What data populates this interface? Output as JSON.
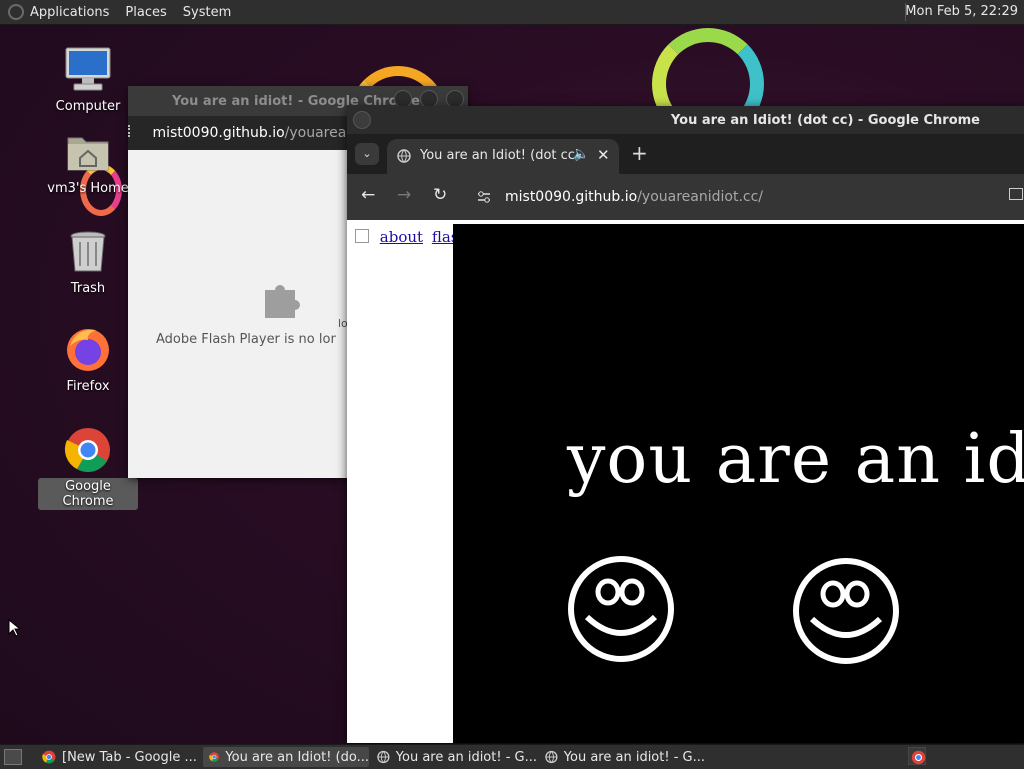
{
  "top_panel": {
    "applications": "Applications",
    "places": "Places",
    "system": "System",
    "clock": "Mon Feb  5, 22:29"
  },
  "desktop_icons": [
    {
      "label": "Computer",
      "icon": "computer-icon"
    },
    {
      "label": "vm3's Home",
      "icon": "home-folder-icon"
    },
    {
      "label": "Trash",
      "icon": "trash-icon"
    },
    {
      "label": "Firefox",
      "icon": "firefox-icon"
    },
    {
      "label": "Google Chrome",
      "icon": "chrome-icon"
    }
  ],
  "back_window": {
    "title": "You are an idiot! - Google Chrome",
    "address_host": "mist0090.github.io",
    "address_path": "/youareanic",
    "plugin_message": "Adobe Flash Player is no longe",
    "partial_text": "lo"
  },
  "front_window": {
    "title": "You are an Idiot! (dot cc) - Google Chrome",
    "tab_title": "You are an Idiot! (dot cc)",
    "address_host": "mist0090.github.io",
    "address_path": "/youareanidiot.cc/",
    "link_about": "about",
    "link_flash": "flash",
    "flash_text": "you are an idi"
  },
  "taskbar": {
    "tasks": [
      {
        "label": "[New Tab - Google ...",
        "icon": "chrome-icon",
        "active": false
      },
      {
        "label": "You are an Idiot! (do...",
        "icon": "chrome-icon",
        "active": true
      },
      {
        "label": "You are an idiot! - G...",
        "icon": "globe-icon",
        "active": false
      },
      {
        "label": "You are an idiot! - G...",
        "icon": "globe-icon",
        "active": false
      }
    ]
  },
  "colors": {
    "panel": "#2f2f2f",
    "desktop": "#2a0d24",
    "link": "#1a0dab"
  }
}
